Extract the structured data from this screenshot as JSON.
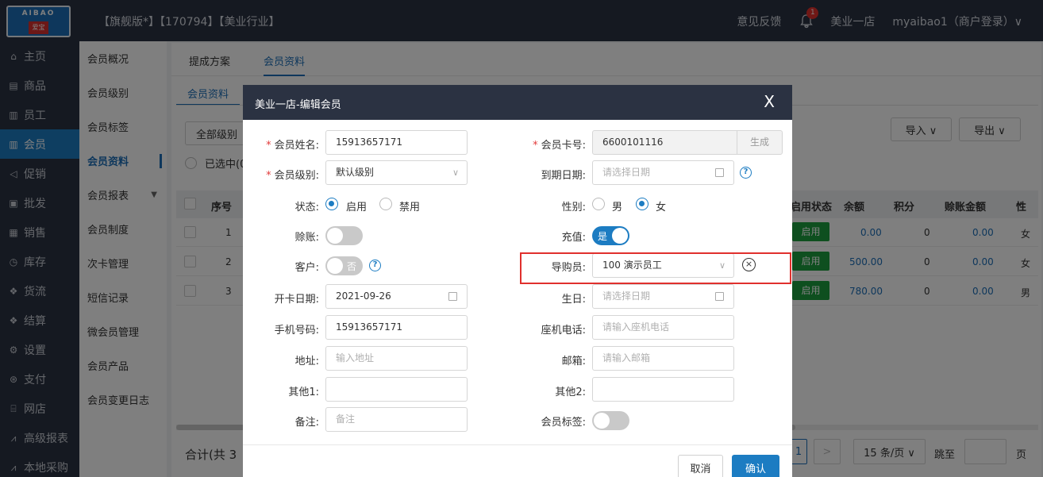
{
  "topbar": {
    "logo_top": "AIBAO",
    "logo_bottom": "爱宝",
    "title": "【旗舰版*】【170794】【美业行业】",
    "feedback": "意见反馈",
    "notif_count": "1",
    "store": "美业一店",
    "user": "myaibao1（商户登录）∨"
  },
  "sidebar": {
    "items": [
      {
        "icon": "home-icon",
        "glyph": "⌂",
        "label": "主页"
      },
      {
        "icon": "goods-icon",
        "glyph": "▤",
        "label": "商品"
      },
      {
        "icon": "staff-icon",
        "glyph": "▥",
        "label": "员工"
      },
      {
        "icon": "member-icon",
        "glyph": "▥",
        "label": "会员"
      },
      {
        "icon": "promo-icon",
        "glyph": "◁",
        "label": "促销"
      },
      {
        "icon": "wholesale-icon",
        "glyph": "▣",
        "label": "批发"
      },
      {
        "icon": "sales-icon",
        "glyph": "▦",
        "label": "销售"
      },
      {
        "icon": "stock-icon",
        "glyph": "◷",
        "label": "库存"
      },
      {
        "icon": "logistics-icon",
        "glyph": "❖",
        "label": "货流"
      },
      {
        "icon": "settle-icon",
        "glyph": "❖",
        "label": "结算"
      },
      {
        "icon": "settings-icon",
        "glyph": "⚙",
        "label": "设置"
      },
      {
        "icon": "pay-icon",
        "glyph": "⊛",
        "label": "支付"
      },
      {
        "icon": "shop-icon",
        "glyph": "⌸",
        "label": "网店"
      },
      {
        "icon": "report-icon",
        "glyph": "⩘",
        "label": "高级报表"
      },
      {
        "icon": "purchase-icon",
        "glyph": "⩘",
        "label": "本地采购"
      }
    ]
  },
  "subnav": {
    "items": [
      "会员概况",
      "会员级别",
      "会员标签",
      "会员资料",
      "会员报表",
      "会员制度",
      "次卡管理",
      "短信记录",
      "微会员管理",
      "会员产品",
      "会员变更日志"
    ]
  },
  "tabs": {
    "plan": "提成方案",
    "profile": "会员资料",
    "sub_profile": "会员资料"
  },
  "toolbar": {
    "level_filter": "全部级别",
    "import": "导入 ∨",
    "export": "导出 ∨",
    "selected": "已选中(0"
  },
  "table": {
    "headers": {
      "seq": "序号",
      "status": "启用状态",
      "balance": "余额",
      "points": "积分",
      "credit": "赊账金额",
      "gender": "性"
    },
    "rows": [
      {
        "seq": "1",
        "status": "启用",
        "balance": "0.00",
        "points": "0",
        "credit": "0.00",
        "gender": "女"
      },
      {
        "seq": "2",
        "status": "启用",
        "balance": "500.00",
        "points": "0",
        "credit": "0.00",
        "gender": "女"
      },
      {
        "seq": "3",
        "status": "启用",
        "balance": "780.00",
        "points": "0",
        "credit": "0.00",
        "gender": "男"
      }
    ]
  },
  "footer": {
    "total": "合计(共 3",
    "page": "1",
    "next": ">",
    "page_size": "15 条/页 ∨",
    "jump": "跳至",
    "page_unit": "页"
  },
  "modal": {
    "title": "美业一店-编辑会员",
    "close": "X",
    "labels": {
      "name": "会员姓名:",
      "card": "会员卡号:",
      "level": "会员级别:",
      "expire": "到期日期:",
      "status": "状态:",
      "gender": "性别:",
      "credit": "赊账:",
      "recharge": "充值:",
      "customer": "客户:",
      "guide": "导购员:",
      "open_date": "开卡日期:",
      "birthday": "生日:",
      "phone": "手机号码:",
      "landline": "座机电话:",
      "address": "地址:",
      "email": "邮箱:",
      "other1": "其他1:",
      "other2": "其他2:",
      "remark": "备注:",
      "tags": "会员标签:"
    },
    "req": "*",
    "values": {
      "name": "15913657171",
      "card": "6600101116",
      "generate": "生成",
      "level": "默认级别",
      "status_on": "启用",
      "status_off": "禁用",
      "male": "男",
      "female": "女",
      "recharge_toggle": "是",
      "customer_toggle": "否",
      "guide": "100 演示员工",
      "open_date": "2021-09-26",
      "phone": "15913657171"
    },
    "placeholders": {
      "expire": "请选择日期",
      "birthday": "请选择日期",
      "landline": "请输入座机电话",
      "address": "输入地址",
      "email": "请输入邮箱",
      "remark": "备注"
    },
    "cancel": "取消",
    "confirm": "确认"
  },
  "colors": {
    "accent": "#1c7cc2",
    "nav": "#2b3242",
    "enabled": "#1d9e3e",
    "highlight": "#e0302d"
  }
}
